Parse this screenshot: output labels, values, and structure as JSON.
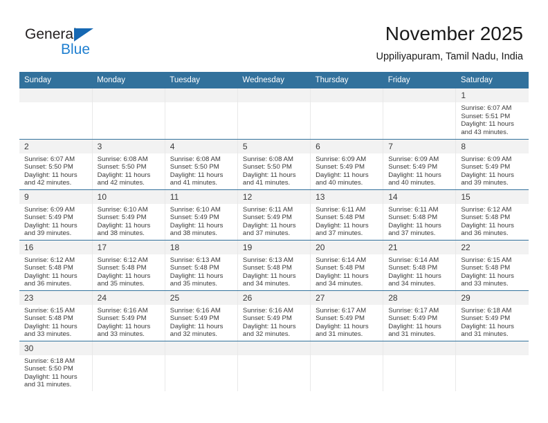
{
  "brand": {
    "name_part1": "General",
    "name_part2": "Blue",
    "accent_color": "#1668b3",
    "accent_color_light": "#1f7fd0"
  },
  "header": {
    "month_title": "November 2025",
    "location": "Uppiliyapuram, Tamil Nadu, India"
  },
  "calendar": {
    "header_bg": "#32719c",
    "daynum_bg": "#f2f2f2",
    "weekdays": [
      "Sunday",
      "Monday",
      "Tuesday",
      "Wednesday",
      "Thursday",
      "Friday",
      "Saturday"
    ],
    "labels": {
      "sunrise": "Sunrise:",
      "sunset": "Sunset:",
      "daylight": "Daylight:"
    },
    "weeks": [
      [
        {
          "day": "",
          "empty": true
        },
        {
          "day": "",
          "empty": true
        },
        {
          "day": "",
          "empty": true
        },
        {
          "day": "",
          "empty": true
        },
        {
          "day": "",
          "empty": true
        },
        {
          "day": "",
          "empty": true
        },
        {
          "day": "1",
          "sunrise": "Sunrise: 6:07 AM",
          "sunset": "Sunset: 5:51 PM",
          "daylight1": "Daylight: 11 hours",
          "daylight2": "and 43 minutes."
        }
      ],
      [
        {
          "day": "2",
          "sunrise": "Sunrise: 6:07 AM",
          "sunset": "Sunset: 5:50 PM",
          "daylight1": "Daylight: 11 hours",
          "daylight2": "and 42 minutes."
        },
        {
          "day": "3",
          "sunrise": "Sunrise: 6:08 AM",
          "sunset": "Sunset: 5:50 PM",
          "daylight1": "Daylight: 11 hours",
          "daylight2": "and 42 minutes."
        },
        {
          "day": "4",
          "sunrise": "Sunrise: 6:08 AM",
          "sunset": "Sunset: 5:50 PM",
          "daylight1": "Daylight: 11 hours",
          "daylight2": "and 41 minutes."
        },
        {
          "day": "5",
          "sunrise": "Sunrise: 6:08 AM",
          "sunset": "Sunset: 5:50 PM",
          "daylight1": "Daylight: 11 hours",
          "daylight2": "and 41 minutes."
        },
        {
          "day": "6",
          "sunrise": "Sunrise: 6:09 AM",
          "sunset": "Sunset: 5:49 PM",
          "daylight1": "Daylight: 11 hours",
          "daylight2": "and 40 minutes."
        },
        {
          "day": "7",
          "sunrise": "Sunrise: 6:09 AM",
          "sunset": "Sunset: 5:49 PM",
          "daylight1": "Daylight: 11 hours",
          "daylight2": "and 40 minutes."
        },
        {
          "day": "8",
          "sunrise": "Sunrise: 6:09 AM",
          "sunset": "Sunset: 5:49 PM",
          "daylight1": "Daylight: 11 hours",
          "daylight2": "and 39 minutes."
        }
      ],
      [
        {
          "day": "9",
          "sunrise": "Sunrise: 6:09 AM",
          "sunset": "Sunset: 5:49 PM",
          "daylight1": "Daylight: 11 hours",
          "daylight2": "and 39 minutes."
        },
        {
          "day": "10",
          "sunrise": "Sunrise: 6:10 AM",
          "sunset": "Sunset: 5:49 PM",
          "daylight1": "Daylight: 11 hours",
          "daylight2": "and 38 minutes."
        },
        {
          "day": "11",
          "sunrise": "Sunrise: 6:10 AM",
          "sunset": "Sunset: 5:49 PM",
          "daylight1": "Daylight: 11 hours",
          "daylight2": "and 38 minutes."
        },
        {
          "day": "12",
          "sunrise": "Sunrise: 6:11 AM",
          "sunset": "Sunset: 5:49 PM",
          "daylight1": "Daylight: 11 hours",
          "daylight2": "and 37 minutes."
        },
        {
          "day": "13",
          "sunrise": "Sunrise: 6:11 AM",
          "sunset": "Sunset: 5:48 PM",
          "daylight1": "Daylight: 11 hours",
          "daylight2": "and 37 minutes."
        },
        {
          "day": "14",
          "sunrise": "Sunrise: 6:11 AM",
          "sunset": "Sunset: 5:48 PM",
          "daylight1": "Daylight: 11 hours",
          "daylight2": "and 37 minutes."
        },
        {
          "day": "15",
          "sunrise": "Sunrise: 6:12 AM",
          "sunset": "Sunset: 5:48 PM",
          "daylight1": "Daylight: 11 hours",
          "daylight2": "and 36 minutes."
        }
      ],
      [
        {
          "day": "16",
          "sunrise": "Sunrise: 6:12 AM",
          "sunset": "Sunset: 5:48 PM",
          "daylight1": "Daylight: 11 hours",
          "daylight2": "and 36 minutes."
        },
        {
          "day": "17",
          "sunrise": "Sunrise: 6:12 AM",
          "sunset": "Sunset: 5:48 PM",
          "daylight1": "Daylight: 11 hours",
          "daylight2": "and 35 minutes."
        },
        {
          "day": "18",
          "sunrise": "Sunrise: 6:13 AM",
          "sunset": "Sunset: 5:48 PM",
          "daylight1": "Daylight: 11 hours",
          "daylight2": "and 35 minutes."
        },
        {
          "day": "19",
          "sunrise": "Sunrise: 6:13 AM",
          "sunset": "Sunset: 5:48 PM",
          "daylight1": "Daylight: 11 hours",
          "daylight2": "and 34 minutes."
        },
        {
          "day": "20",
          "sunrise": "Sunrise: 6:14 AM",
          "sunset": "Sunset: 5:48 PM",
          "daylight1": "Daylight: 11 hours",
          "daylight2": "and 34 minutes."
        },
        {
          "day": "21",
          "sunrise": "Sunrise: 6:14 AM",
          "sunset": "Sunset: 5:48 PM",
          "daylight1": "Daylight: 11 hours",
          "daylight2": "and 34 minutes."
        },
        {
          "day": "22",
          "sunrise": "Sunrise: 6:15 AM",
          "sunset": "Sunset: 5:48 PM",
          "daylight1": "Daylight: 11 hours",
          "daylight2": "and 33 minutes."
        }
      ],
      [
        {
          "day": "23",
          "sunrise": "Sunrise: 6:15 AM",
          "sunset": "Sunset: 5:48 PM",
          "daylight1": "Daylight: 11 hours",
          "daylight2": "and 33 minutes."
        },
        {
          "day": "24",
          "sunrise": "Sunrise: 6:16 AM",
          "sunset": "Sunset: 5:49 PM",
          "daylight1": "Daylight: 11 hours",
          "daylight2": "and 33 minutes."
        },
        {
          "day": "25",
          "sunrise": "Sunrise: 6:16 AM",
          "sunset": "Sunset: 5:49 PM",
          "daylight1": "Daylight: 11 hours",
          "daylight2": "and 32 minutes."
        },
        {
          "day": "26",
          "sunrise": "Sunrise: 6:16 AM",
          "sunset": "Sunset: 5:49 PM",
          "daylight1": "Daylight: 11 hours",
          "daylight2": "and 32 minutes."
        },
        {
          "day": "27",
          "sunrise": "Sunrise: 6:17 AM",
          "sunset": "Sunset: 5:49 PM",
          "daylight1": "Daylight: 11 hours",
          "daylight2": "and 31 minutes."
        },
        {
          "day": "28",
          "sunrise": "Sunrise: 6:17 AM",
          "sunset": "Sunset: 5:49 PM",
          "daylight1": "Daylight: 11 hours",
          "daylight2": "and 31 minutes."
        },
        {
          "day": "29",
          "sunrise": "Sunrise: 6:18 AM",
          "sunset": "Sunset: 5:49 PM",
          "daylight1": "Daylight: 11 hours",
          "daylight2": "and 31 minutes."
        }
      ],
      [
        {
          "day": "30",
          "sunrise": "Sunrise: 6:18 AM",
          "sunset": "Sunset: 5:50 PM",
          "daylight1": "Daylight: 11 hours",
          "daylight2": "and 31 minutes."
        },
        {
          "day": "",
          "empty": true
        },
        {
          "day": "",
          "empty": true
        },
        {
          "day": "",
          "empty": true
        },
        {
          "day": "",
          "empty": true
        },
        {
          "day": "",
          "empty": true
        },
        {
          "day": "",
          "empty": true
        }
      ]
    ]
  }
}
